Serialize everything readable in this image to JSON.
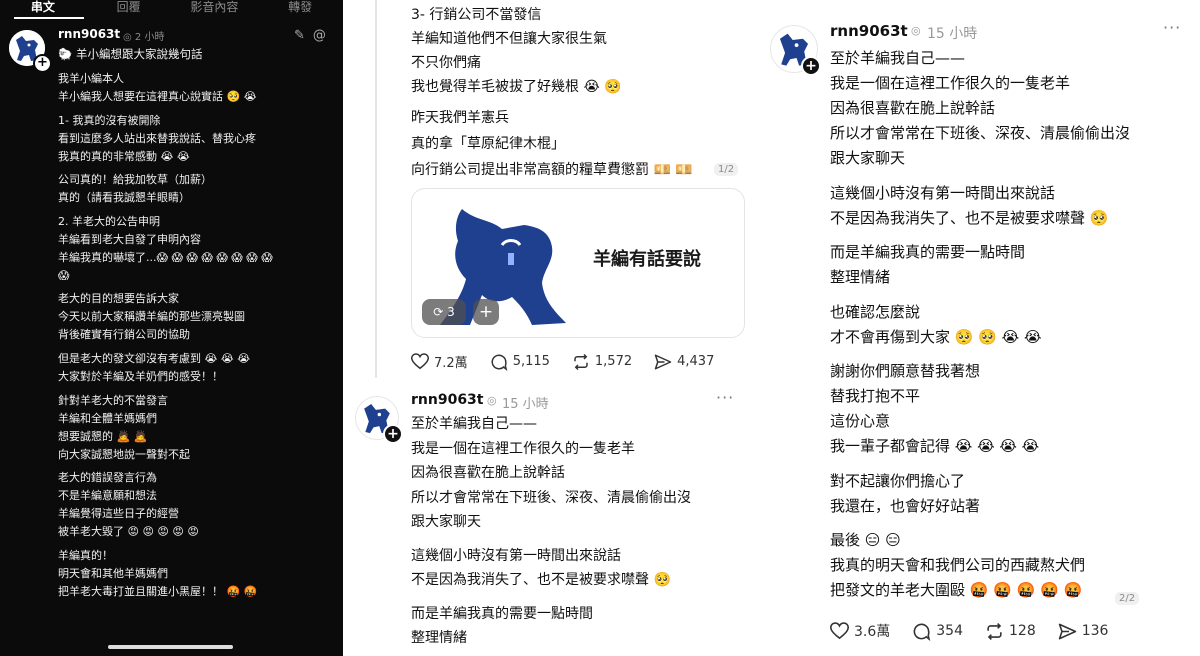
{
  "left": {
    "tabs": [
      "串文",
      "回覆",
      "影音內容",
      "轉發"
    ],
    "username": "rnn9063t",
    "time": "2 小時",
    "intro": "🐑 羊小編想跟大家說幾句話",
    "paragraphs": [
      [
        "我羊小編本人",
        "羊小編我人想要在這裡真心說實話 🥺 😭"
      ],
      [
        "1- 我真的沒有被開除",
        "看到這麼多人站出來替我說話、替我心疼",
        "我真的真的非常感動 😭 😭"
      ],
      [
        "公司真的！給我加牧草（加薪）",
        "真的（請看我誠懇羊眼睛）"
      ],
      [
        "2. 羊老大的公告申明",
        "羊編看到老大自發了申明內容",
        "羊編我真的嚇壞了...😱 😱 😱 😱 😱 😱 😱 😱",
        "😱"
      ],
      [
        "老大的目的想要告訴大家",
        "今天以前大家稱讚羊編的那些漂亮製圖",
        "背後確實有行銷公司的協助"
      ],
      [
        "但是老大的發文卻沒有考慮到 😭 😭 😭",
        "大家對於羊編及羊奶們的感受！！"
      ],
      [
        "針對羊老大的不當發言",
        "羊編和全體羊媽媽們",
        "想要誠懇的 🙇 🙇",
        "向大家誠懇地說一聲對不起"
      ],
      [
        "老大的錯誤發言行為",
        "不是羊編意願和想法",
        "羊編覺得這些日子的經營",
        "被羊老大毀了 😡 😡 😡 😡 😡"
      ],
      [
        "羊編真的！",
        "明天會和其他羊媽媽們",
        "把羊老大毒打並且關進小黑屋！！ 🤬 🤬"
      ]
    ]
  },
  "middle": {
    "block1": [
      "3- 行銷公司不當發信",
      "羊編知道他們不但讓大家很生氣",
      "不只你們痛",
      "我也覺得羊毛被拔了好幾根 😭 🥺"
    ],
    "block2": [
      "昨天我們羊憲兵",
      "真的拿「草原紀律木棍」",
      "向行銷公司提出非常高額的糧草費懲罰 💴 💴"
    ],
    "pager": "1/2",
    "card": {
      "title": "羊編有話要說",
      "repost_pill": "3"
    },
    "actions": {
      "likes": "7.2萬",
      "comments": "5,115",
      "reposts": "1,572",
      "shares": "4,437"
    },
    "post2": {
      "username": "rnn9063t",
      "time": "15 小時",
      "paragraphs": [
        [
          "至於羊編我自己——",
          "我是一個在這裡工作很久的一隻老羊",
          "因為很喜歡在脆上說幹話",
          "所以才會常常在下班後、深夜、清晨偷偷出沒",
          "跟大家聊天"
        ],
        [
          "這幾個小時沒有第一時間出來說話",
          "不是因為我消失了、也不是被要求噤聲 🥺"
        ],
        [
          "而是羊編我真的需要一點時間",
          "整理情緒"
        ]
      ]
    }
  },
  "right": {
    "username": "rnn9063t",
    "time": "15 小時",
    "paragraphs": [
      [
        "至於羊編我自己——",
        "我是一個在這裡工作很久的一隻老羊",
        "因為很喜歡在脆上說幹話",
        "所以才會常常在下班後、深夜、清晨偷偷出沒",
        "跟大家聊天"
      ],
      [
        "這幾個小時沒有第一時間出來說話",
        "不是因為我消失了、也不是被要求噤聲 🥺"
      ],
      [
        "而是羊編我真的需要一點時間",
        "整理情緒"
      ],
      [
        "也確認怎麼說",
        "才不會再傷到大家 🥺 🥺 😭 😭"
      ],
      [
        "謝謝你們願意替我著想",
        "替我打抱不平",
        "這份心意",
        "我一輩子都會記得 😭 😭 😭 😭"
      ],
      [
        "對不起讓你們擔心了",
        "我還在，也會好好站著"
      ],
      [
        "最後 😑 😑",
        "我真的明天會和我們公司的西藏熬犬們",
        "把發文的羊老大圍毆 🤬 🤬 🤬 🤬 🤬"
      ]
    ],
    "pager": "2/2",
    "actions": {
      "likes": "3.6萬",
      "comments": "354",
      "reposts": "128",
      "shares": "136"
    }
  },
  "icons": [
    "verified-icon",
    "more-icon",
    "heart-icon",
    "comment-icon",
    "repost-icon",
    "share-icon",
    "edit-icon",
    "threads-icon",
    "plus-icon"
  ],
  "colors": {
    "dark_bg": "#0b0b0b",
    "text": "#111111",
    "muted": "#999999",
    "border": "#e4e4e4",
    "logo_blue": "#1f3f8f"
  }
}
